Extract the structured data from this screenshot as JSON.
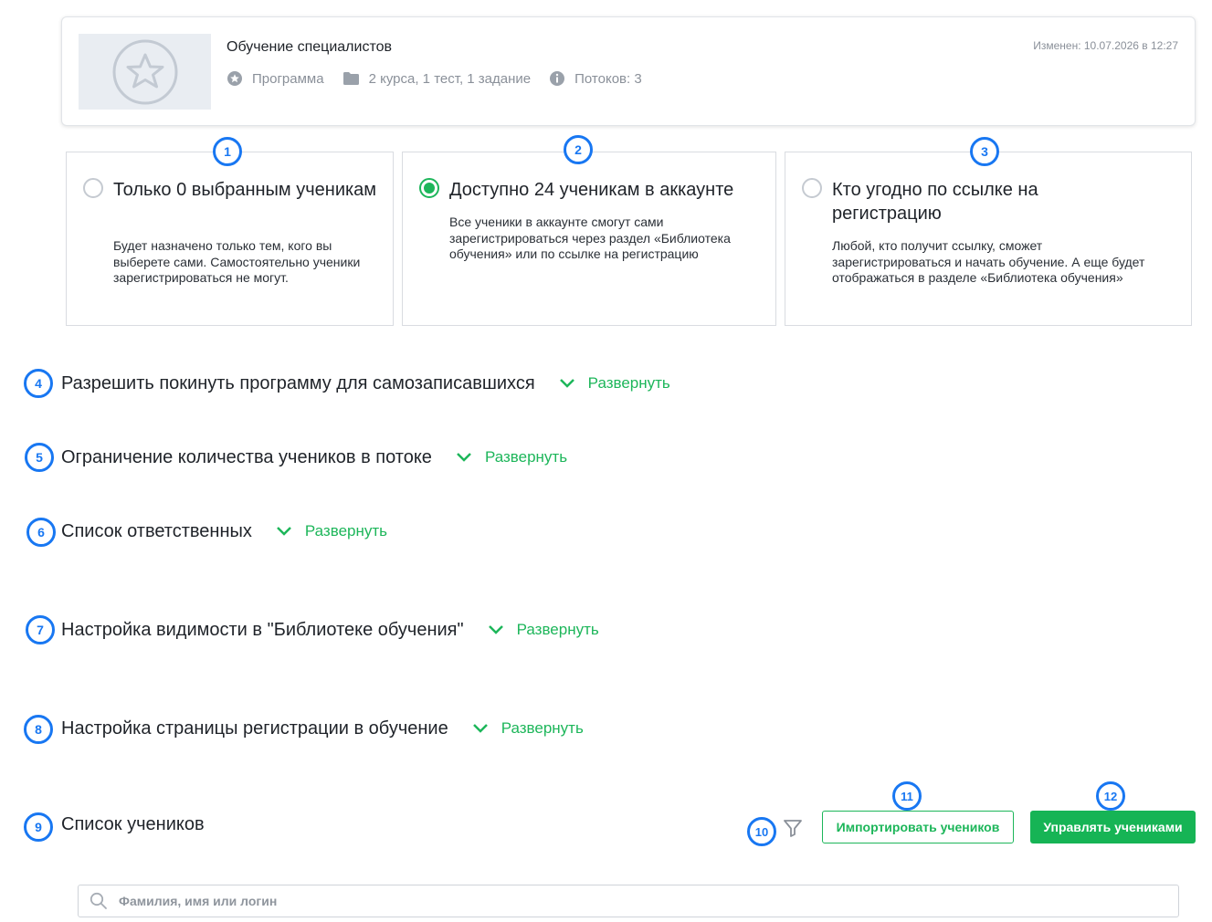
{
  "program": {
    "title": "Обучение специалистов",
    "modified": "Изменен: 10.07.2026 в 12:27",
    "type_label": "Программа",
    "content_summary": "2 курса, 1 тест, 1 задание",
    "streams": "Потоков: 3"
  },
  "badges": [
    "1",
    "2",
    "3",
    "4",
    "5",
    "6",
    "7",
    "8",
    "9",
    "10",
    "11",
    "12"
  ],
  "access_options": [
    {
      "title": "Только 0 выбранным ученикам",
      "description": "Будет назначено только тем, кого вы выберете сами. Самостоятельно ученики зарегистрироваться не могут.",
      "selected": false
    },
    {
      "title": "Доступно 24 ученикам в аккаунте",
      "description": "Все ученики в аккаунте смогут сами зарегистрироваться через раздел «Библиотека обучения» или по ссылке на регистрацию",
      "selected": true
    },
    {
      "title": "Кто угодно по ссылке на регистрацию",
      "description": "Любой, кто получит ссылку, сможет зарегистрироваться и начать обучение. А еще будет отображаться в разделе «Библиотека обучения»",
      "selected": false
    }
  ],
  "sections": [
    {
      "title": "Разрешить покинуть программу для самозаписавшихся",
      "expand_label": "Развернуть"
    },
    {
      "title": "Ограничение количества учеников в потоке",
      "expand_label": "Развернуть"
    },
    {
      "title": "Список ответственных",
      "expand_label": "Развернуть"
    },
    {
      "title": "Настройка видимости в \"Библиотеке обучения\"",
      "expand_label": "Развернуть"
    },
    {
      "title": "Настройка страницы регистрации в обучение",
      "expand_label": "Развернуть"
    }
  ],
  "students": {
    "title": "Список учеников",
    "import_label": "Импортировать учеников",
    "manage_label": "Управлять учениками",
    "search_placeholder": "Фамилия, имя или логин"
  },
  "colors": {
    "accent_green": "#16b455",
    "badge_blue": "#1877f2",
    "muted_text": "#8a9099"
  },
  "icons": [
    "star-icon",
    "folder-icon",
    "info-icon",
    "chevron-down-icon",
    "filter-icon",
    "search-icon"
  ]
}
